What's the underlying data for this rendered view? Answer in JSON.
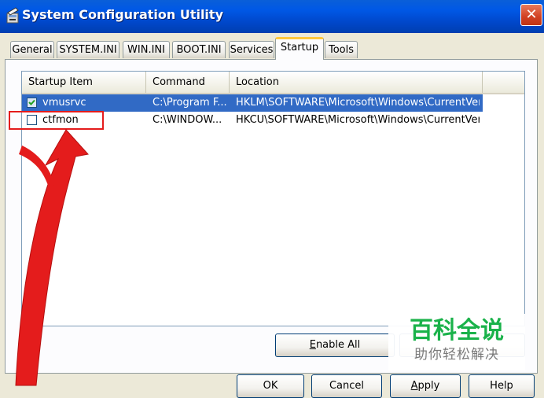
{
  "window": {
    "title": "System Configuration Utility",
    "close_glyph": "✕",
    "title_icon": "msconfig-icon"
  },
  "tabs": [
    {
      "label": "General"
    },
    {
      "label": "SYSTEM.INI"
    },
    {
      "label": "WIN.INI"
    },
    {
      "label": "BOOT.INI"
    },
    {
      "label": "Services"
    },
    {
      "label": "Startup",
      "active": true
    },
    {
      "label": "Tools"
    }
  ],
  "startup_list": {
    "columns": [
      "Startup Item",
      "Command",
      "Location"
    ],
    "rows": [
      {
        "checked": true,
        "selected": true,
        "item": "vmusrvc",
        "command": "C:\\Program F...",
        "location": "HKLM\\SOFTWARE\\Microsoft\\Windows\\CurrentVer..."
      },
      {
        "checked": false,
        "selected": false,
        "item": "ctfmon",
        "command": "C:\\WINDOW...",
        "location": "HKCU\\SOFTWARE\\Microsoft\\Windows\\CurrentVer..."
      }
    ]
  },
  "buttons": {
    "enable_all": {
      "underlined": "E",
      "rest": "nable All"
    },
    "ok": "OK",
    "cancel": "Cancel",
    "apply": {
      "underlined": "A",
      "rest": "pply"
    },
    "help": "Help"
  },
  "watermark": {
    "title": "百科全说",
    "subtitle": "助你轻松解决"
  },
  "colors": {
    "titlebar": "#0054e3",
    "selection": "#316ac5",
    "annotation": "#e41c1c",
    "watermark_green": "#1ab24a"
  }
}
